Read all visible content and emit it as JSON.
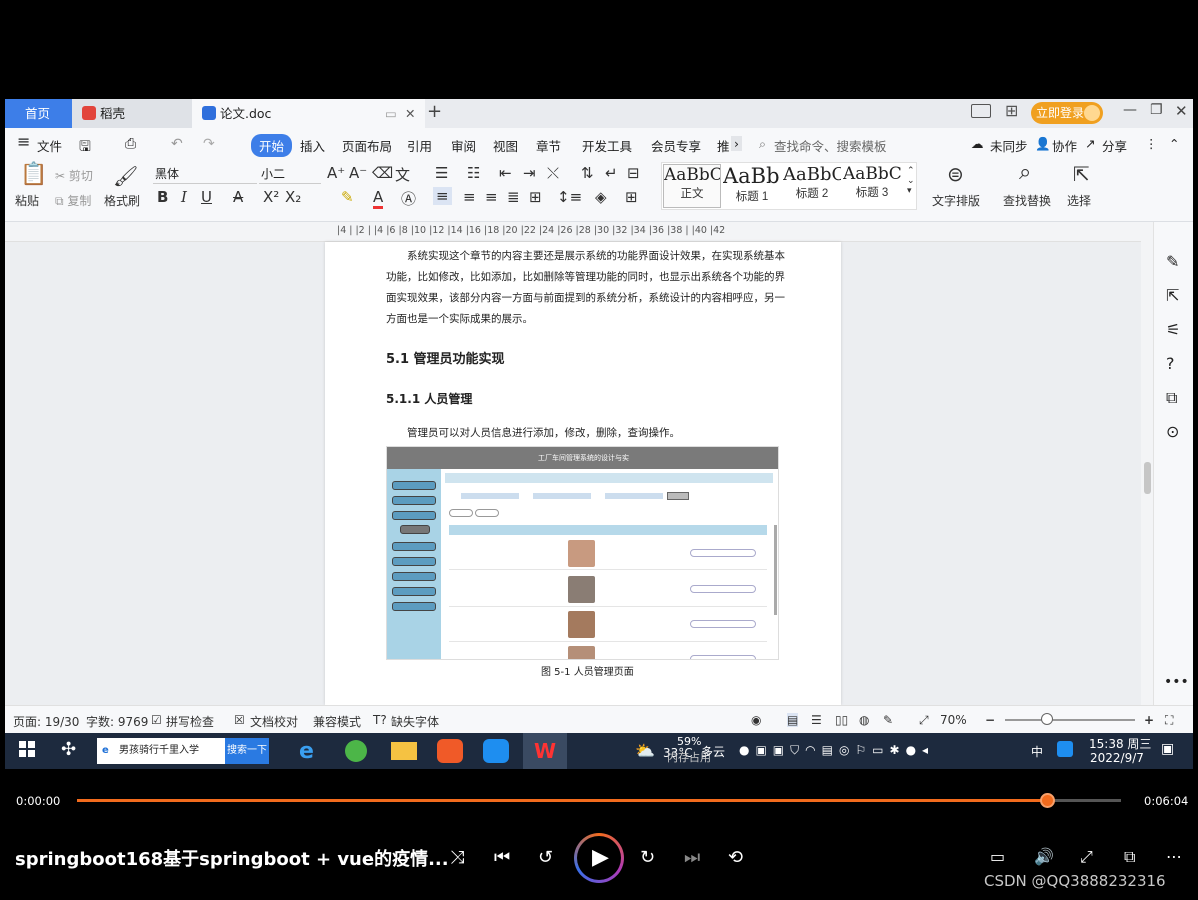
{
  "tabs": {
    "home": "首页",
    "daoke": "稻壳",
    "doc": "论文.doc"
  },
  "top_right": {
    "login": "立即登录"
  },
  "menu": {
    "file": "文件",
    "items": [
      "开始",
      "插入",
      "页面布局",
      "引用",
      "审阅",
      "视图",
      "章节",
      "开发工具",
      "会员专享",
      "推"
    ],
    "search_placeholder": "查找命令、搜索模板",
    "unsynced": "未同步",
    "collab": "协作",
    "share": "分享"
  },
  "ribbon": {
    "paste": "粘贴",
    "cut": "剪切",
    "copy": "复制",
    "format_painter": "格式刷",
    "font_name": "黑体",
    "font_size": "小二",
    "styles": [
      {
        "sample": "AaBbCcI",
        "label": "正文"
      },
      {
        "sample": "AaBb(",
        "label": "标题 1"
      },
      {
        "sample": "AaBbC",
        "label": "标题 2"
      },
      {
        "sample": "AaBbCc",
        "label": "标题 3"
      }
    ],
    "text_layout": "文字排版",
    "find_replace": "查找替换",
    "select": "选择"
  },
  "ruler": {
    "marks": "|4 |  |2 |  |4 |6 |8 |10 |12 |14 |16 |18 |20 |22 |24 |26 |28 |30 |32 |34 |36 |38 |  |40 |42"
  },
  "document": {
    "para1": [
      "系统实现这个章节的内容主要还是展示系统的功能界面设计效果，在实现系统基本",
      "功能，比如修改，比如添加，比如删除等管理功能的同时，也显示出系统各个功能的界",
      "面实现效果，该部分内容一方面与前面提到的系统分析，系统设计的内容相呼应，另一",
      "方面也是一个实际成果的展示。"
    ],
    "heading2": "5.1 管理员功能实现",
    "heading3": "5.1.1  人员管理",
    "para2": "管理员可以对人员信息进行添加，修改，删除，查询操作。",
    "figure_title": "工厂车间管理系统的设计与实",
    "caption": "图 5-1  人员管理页面"
  },
  "status": {
    "page": "页面: 19/30",
    "words": "字数: 9769",
    "spell": "拼写检查",
    "proof": "文档校对",
    "compat": "兼容模式",
    "missing_font": "缺失字体",
    "zoom": "70%"
  },
  "taskbar": {
    "search_text": "男孩骑行千里入学",
    "search_button": "搜索一下",
    "weather_temp": "33°C",
    "weather_desc": "多云",
    "mem_pct": "59%",
    "mem_label": "内存占用",
    "lang": "中",
    "time": "15:38 周三",
    "date": "2022/9/7"
  },
  "player": {
    "elapsed": "0:00:00",
    "total": "0:06:04",
    "progress": 0.93,
    "title": "springboot168基于springboot + vue的疫情...",
    "watermark": "CSDN @QQ3888232316"
  },
  "colors": {
    "accent": "#3d7ee8",
    "progress": "#f26b1d",
    "login": "#f0a020"
  }
}
